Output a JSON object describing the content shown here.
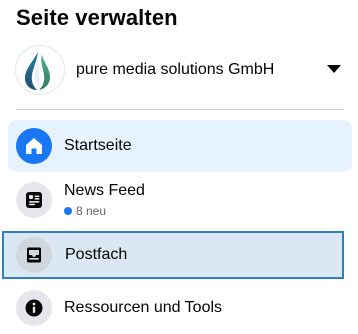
{
  "header": {
    "title": "Seite verwalten"
  },
  "page_selector": {
    "name": "pure media solutions GmbH",
    "avatar_icon": "water-drop-logo-icon",
    "caret_icon": "caret-down-icon"
  },
  "nav": {
    "items": [
      {
        "label": "Startseite",
        "icon": "home-icon",
        "state": "active"
      },
      {
        "label": "News Feed",
        "icon": "news-feed-icon",
        "sub_count": "8 neu"
      },
      {
        "label": "Postfach",
        "icon": "inbox-icon",
        "state": "focused"
      },
      {
        "label": "Ressourcen und Tools",
        "icon": "info-icon"
      }
    ]
  },
  "colors": {
    "accent": "#1877f2",
    "active_bg": "#e7f3ff",
    "focused_bg": "#dbe8f3",
    "focused_border": "#2d83b8",
    "icon_bg": "#e4e6eb",
    "text": "#050505",
    "secondary_text": "#65676b"
  }
}
